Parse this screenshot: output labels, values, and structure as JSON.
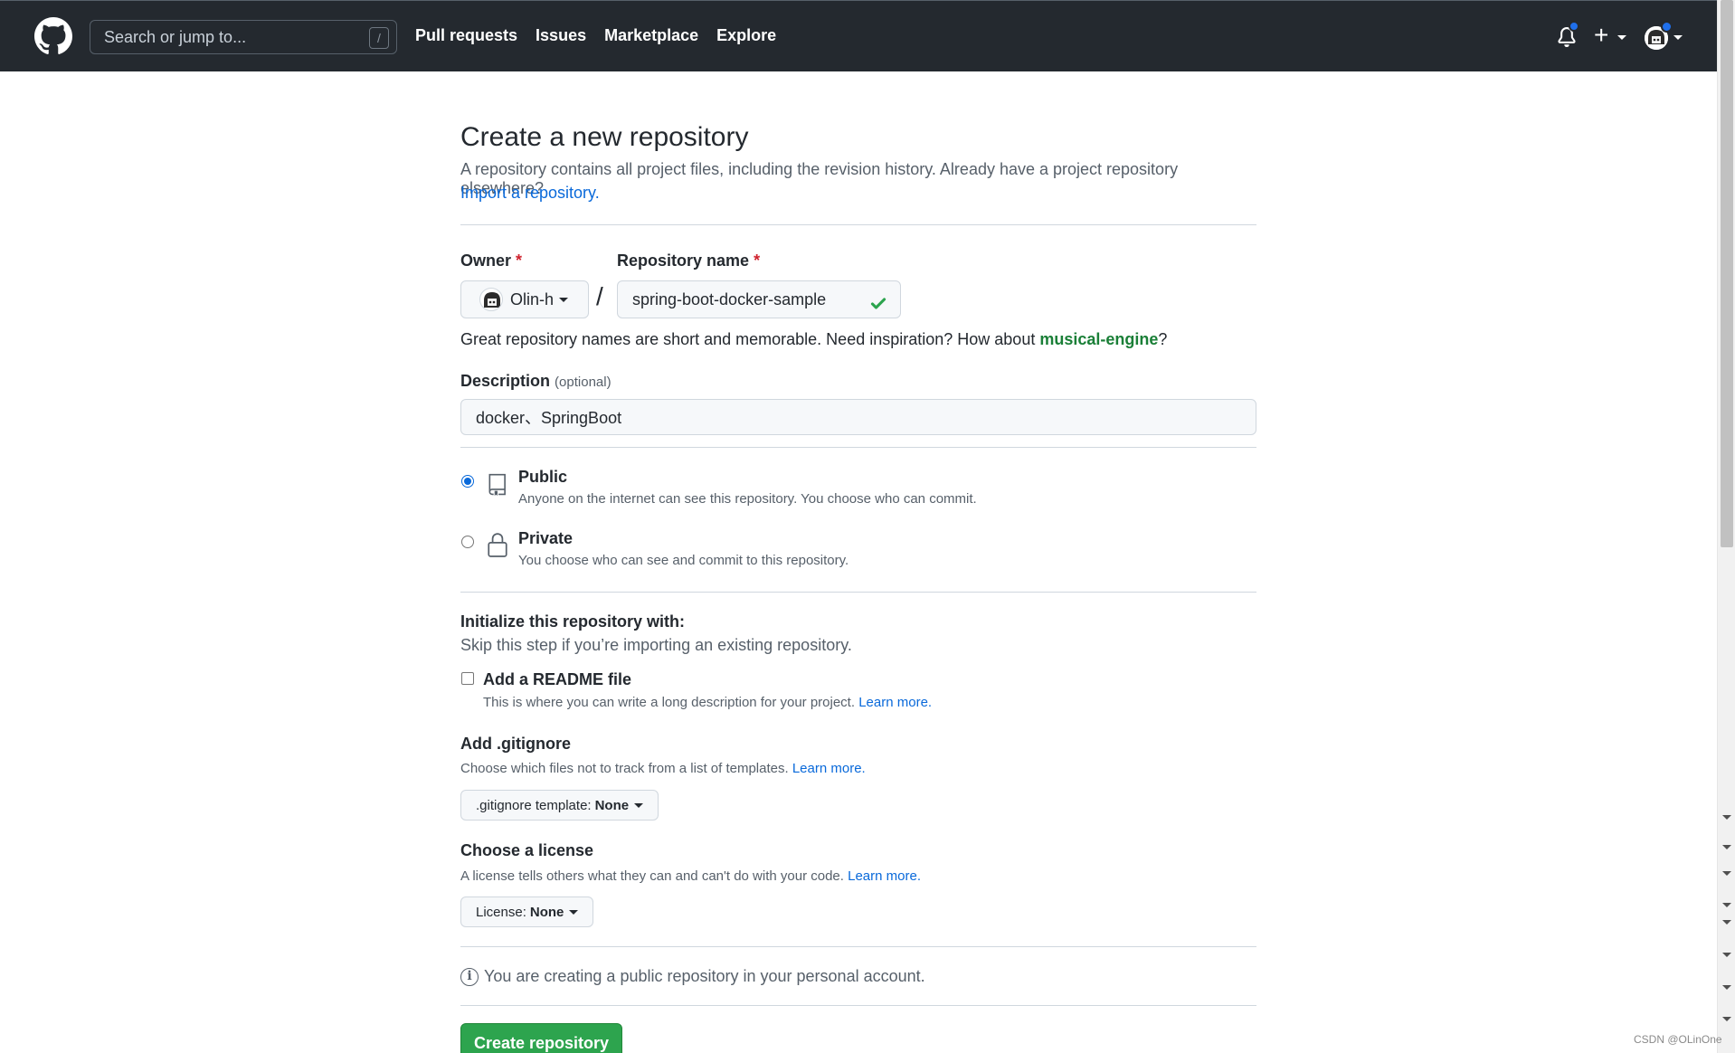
{
  "header": {
    "search_placeholder": "Search or jump to...",
    "search_shortcut": "/",
    "nav": [
      "Pull requests",
      "Issues",
      "Marketplace",
      "Explore"
    ],
    "plus_label": "+"
  },
  "page": {
    "title": "Create a new repository",
    "subhead": "A repository contains all project files, including the revision history. Already have a project repository elsewhere?",
    "import_link": "Import a repository.",
    "owner_label": "Owner",
    "required_mark": "*",
    "owner_name": "Olin-h",
    "separator": "/",
    "repo_label": "Repository name",
    "repo_value": "spring-boot-docker-sample",
    "hint_prefix": "Great repository names are short and memorable. Need inspiration? How about ",
    "hint_suggestion": "musical-engine",
    "hint_suffix": "?",
    "description_label": "Description",
    "description_optional": "(optional)",
    "description_value": "docker、SpringBoot",
    "visibility": [
      {
        "title": "Public",
        "desc": "Anyone on the internet can see this repository. You choose who can commit.",
        "checked": true,
        "icon": "repo-icon"
      },
      {
        "title": "Private",
        "desc": "You choose who can see and commit to this repository.",
        "checked": false,
        "icon": "lock-icon"
      }
    ],
    "init_title": "Initialize this repository with:",
    "init_sub": "Skip this step if you’re importing an existing repository.",
    "readme_title": "Add a README file",
    "readme_desc": "This is where you can write a long description for your project.",
    "learn_more": "Learn more.",
    "gitignore_title": "Add .gitignore",
    "gitignore_desc": "Choose which files not to track from a list of templates.",
    "gitignore_select_label": ".gitignore template:",
    "gitignore_select_value": "None",
    "license_title": "Choose a license",
    "license_desc": "A license tells others what they can and can't do with your code.",
    "license_select_label": "License:",
    "license_select_value": "None",
    "info_text": "You are creating a public repository in your personal account.",
    "create_button": "Create repository"
  },
  "watermark": "CSDN @OLinOne",
  "colors": {
    "header_bg": "#24292f",
    "link": "#0969da",
    "primary_button": "#2da44e",
    "success": "#1a7f37",
    "required": "#cf222e"
  }
}
